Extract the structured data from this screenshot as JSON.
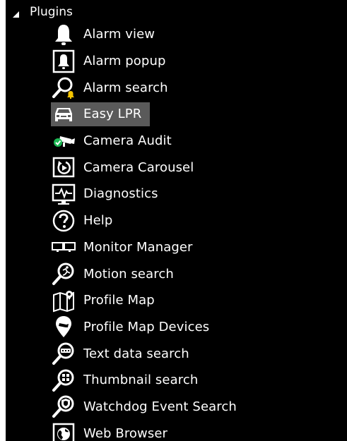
{
  "group": {
    "title": "Plugins"
  },
  "items": [
    {
      "label": "Alarm view",
      "icon": "bell-icon"
    },
    {
      "label": "Alarm popup",
      "icon": "alarm-popup-icon"
    },
    {
      "label": "Alarm search",
      "icon": "alarm-search-icon"
    },
    {
      "label": "Easy LPR",
      "icon": "car-icon",
      "selected": true
    },
    {
      "label": "Camera Audit",
      "icon": "camera-audit-icon"
    },
    {
      "label": "Camera Carousel",
      "icon": "camera-carousel-icon"
    },
    {
      "label": "Diagnostics",
      "icon": "diagnostics-icon"
    },
    {
      "label": "Help",
      "icon": "help-icon"
    },
    {
      "label": "Monitor Manager",
      "icon": "monitor-manager-icon"
    },
    {
      "label": "Motion search",
      "icon": "motion-search-icon"
    },
    {
      "label": "Profile Map",
      "icon": "map-icon"
    },
    {
      "label": "Profile Map Devices",
      "icon": "map-pin-icon"
    },
    {
      "label": "Text data search",
      "icon": "text-search-icon"
    },
    {
      "label": "Thumbnail search",
      "icon": "thumbnail-search-icon"
    },
    {
      "label": "Watchdog Event Search",
      "icon": "watchdog-search-icon"
    },
    {
      "label": "Web Browser",
      "icon": "globe-icon"
    }
  ],
  "colors": {
    "background": "#000000",
    "text": "#ffffff",
    "selection": "#5a5a5a",
    "accent_yellow": "#f5c400",
    "accent_green": "#1db954"
  }
}
